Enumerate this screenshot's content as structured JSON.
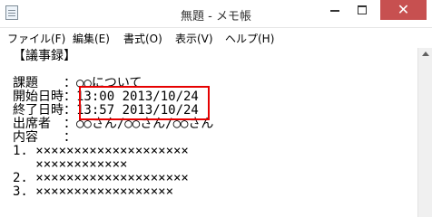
{
  "window": {
    "title": "無題 - メモ帳",
    "controls": {
      "minimize": "minimize",
      "maximize": "maximize",
      "close": "✕"
    }
  },
  "menu": [
    "ファイル(F)",
    "編集(E)",
    "書式(O)",
    "表示(V)",
    "ヘルプ(H)"
  ],
  "document": {
    "lines": [
      "【議事録】",
      "",
      "課題　　：○○について",
      "開始日時：13:00 2013/10/24",
      "終了日時：13:57 2013/10/24",
      "出席者　：○○さん/○○さん/○○さん",
      "内容　　：",
      "1. ××××××××××××××××××××",
      "   ××××××××××××",
      "2. ××××××××××××××××××××",
      "3. ××××××××××××××××××"
    ]
  },
  "highlight_color": "#e60000"
}
